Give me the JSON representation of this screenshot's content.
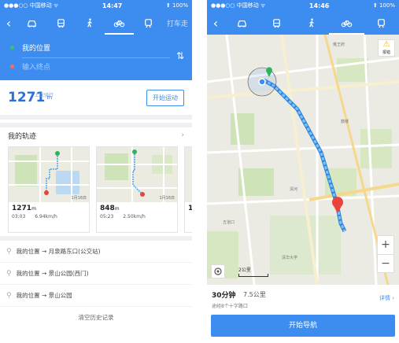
{
  "left": {
    "status": {
      "carrier": "●●●○○ 中国移动 ᯤ",
      "time": "14:47",
      "battery": "⬆ 100%"
    },
    "modes": {
      "taxi_label": "打车走"
    },
    "route": {
      "origin": "我的位置",
      "destination_placeholder": "输入终点"
    },
    "distance": {
      "value": "1271",
      "unit": "m",
      "caption": "上次骑行",
      "start_button": "开始运动"
    },
    "tracks": {
      "title": "我的轨迹",
      "cards": [
        {
          "distance": "1271",
          "unit": "m",
          "duration": "03:03",
          "speed": "6.94km/h",
          "date": "1月16日"
        },
        {
          "distance": "848",
          "unit": "m",
          "duration": "05:23",
          "speed": "2.50km/h",
          "date": "1月16日"
        },
        {
          "distance": "1"
        }
      ]
    },
    "history": [
      "我的位置 → 月泉路东口(公交站)",
      "我的位置 → 景山公园(西门)",
      "我的位置 → 景山公园"
    ],
    "clear_label": "清空历史记录"
  },
  "right": {
    "status": {
      "carrier": "●●●○○ 中国移动 ᯤ",
      "time": "14:46",
      "battery": "⬆ 100%"
    },
    "warn_label": "报错",
    "scale_label": "2公里",
    "route_time": "30分钟",
    "route_distance": "7.5公里",
    "route_via": "途经8个十字路口",
    "detail_label": "详情 ›",
    "nav_button": "开始导航",
    "zoom_in": "+",
    "zoom_out": "−"
  },
  "colors": {
    "accent": "#3d8df0",
    "route": "#4aa3ee",
    "marker": "#e8433c",
    "start": "#2fb35c"
  },
  "icons": [
    "back-icon",
    "car-icon",
    "bus-icon",
    "walk-icon",
    "bike-icon",
    "train-icon",
    "swap-icon",
    "search-icon",
    "chevron-right-icon",
    "warning-icon",
    "locate-icon"
  ]
}
